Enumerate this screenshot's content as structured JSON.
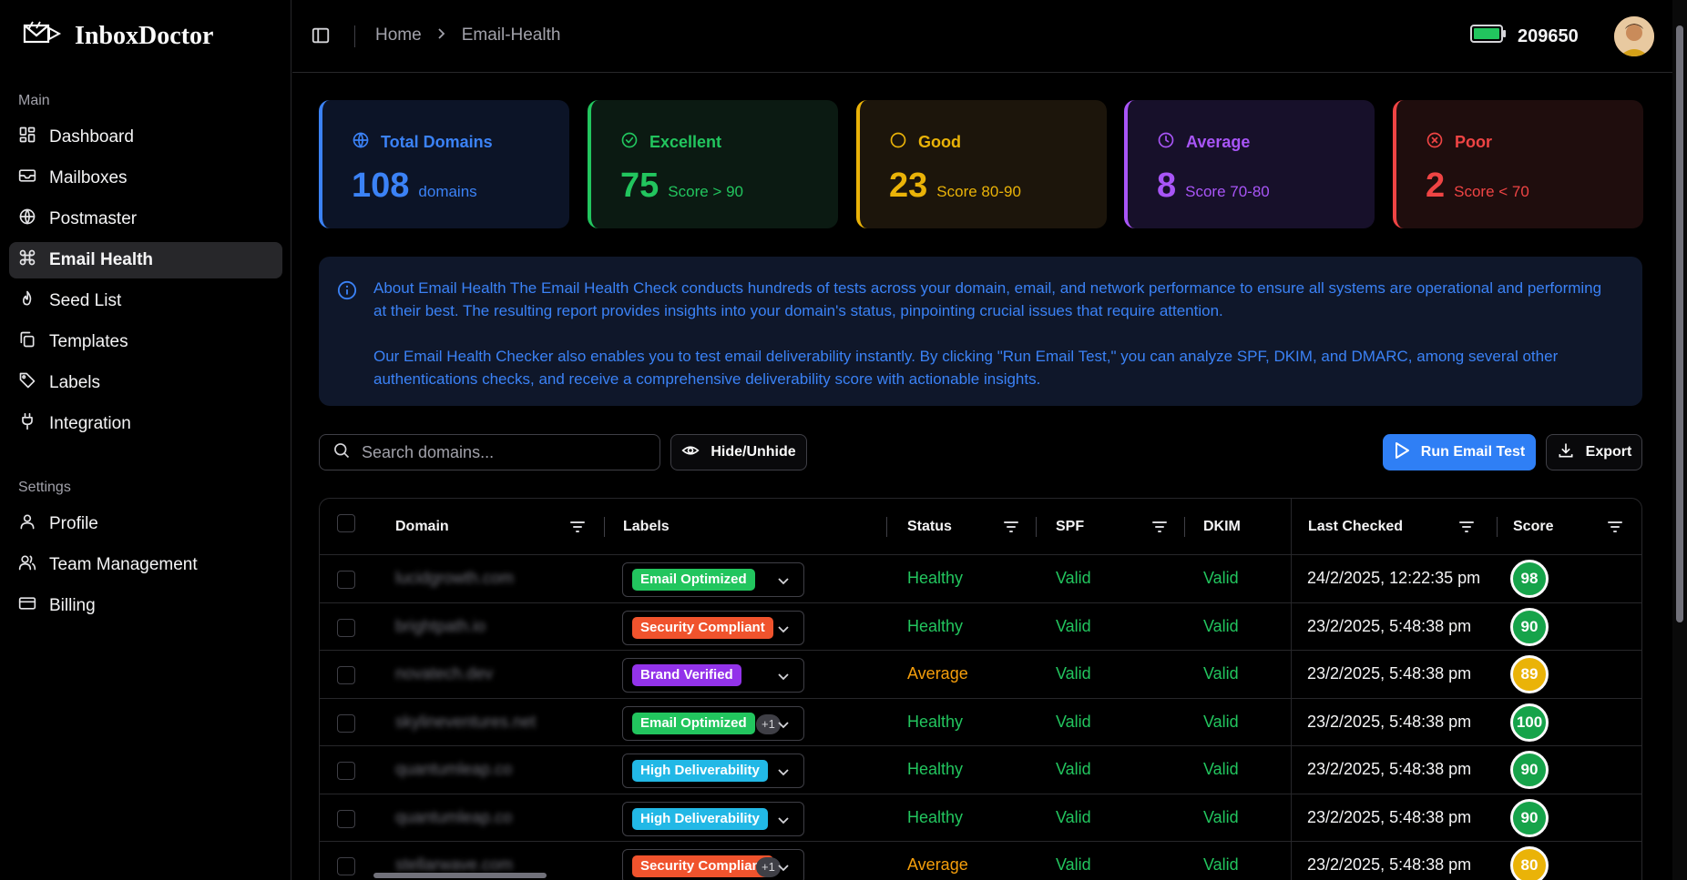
{
  "brand": {
    "name": "InboxDoctor"
  },
  "sidebar": {
    "main_label": "Main",
    "main_items": [
      {
        "label": "Dashboard",
        "icon": "dashboard-icon",
        "active": false
      },
      {
        "label": "Mailboxes",
        "icon": "mailbox-icon",
        "active": false
      },
      {
        "label": "Postmaster",
        "icon": "globe-icon",
        "active": false
      },
      {
        "label": "Email Health",
        "icon": "command-icon",
        "active": true
      },
      {
        "label": "Seed List",
        "icon": "flame-icon",
        "active": false
      },
      {
        "label": "Templates",
        "icon": "copy-icon",
        "active": false
      },
      {
        "label": "Labels",
        "icon": "tag-icon",
        "active": false
      },
      {
        "label": "Integration",
        "icon": "plug-icon",
        "active": false
      }
    ],
    "settings_label": "Settings",
    "settings_items": [
      {
        "label": "Profile",
        "icon": "user-icon"
      },
      {
        "label": "Team Management",
        "icon": "users-icon"
      },
      {
        "label": "Billing",
        "icon": "credit-card-icon"
      }
    ]
  },
  "topbar": {
    "breadcrumb": [
      "Home",
      "Email-Health"
    ],
    "credits": "209650"
  },
  "stats": [
    {
      "title": "Total Domains",
      "value": "108",
      "sub": "domains",
      "color": "#3b82f6",
      "bg": "#0c1427",
      "icon": "globe-icon"
    },
    {
      "title": "Excellent",
      "value": "75",
      "sub": "Score > 90",
      "color": "#22c55e",
      "bg": "#0b1a12",
      "icon": "check-circle-icon"
    },
    {
      "title": "Good",
      "value": "23",
      "sub": "Score 80-90",
      "color": "#eab308",
      "bg": "#1c150b",
      "icon": "circle-icon"
    },
    {
      "title": "Average",
      "value": "8",
      "sub": "Score 70-80",
      "color": "#a855f7",
      "bg": "#17102a",
      "icon": "clock-icon"
    },
    {
      "title": "Poor",
      "value": "2",
      "sub": "Score < 70",
      "color": "#ef4444",
      "bg": "#1f0d0d",
      "icon": "x-circle-icon"
    }
  ],
  "info": {
    "paragraph1": "About Email Health The Email Health Check conducts hundreds of tests across your domain, email, and network performance to ensure all systems are operational and performing at their best. The resulting report provides insights into your domain's status, pinpointing crucial issues that require attention.",
    "paragraph2": "Our Email Health Checker also enables you to test email deliverability instantly. By clicking \"Run Email Test,\" you can analyze SPF, DKIM, and DMARC, among several other authentications checks, and receive a comprehensive deliverability score with actionable insights."
  },
  "toolbar": {
    "search_placeholder": "Search domains...",
    "hide_label": "Hide/Unhide",
    "run_label": "Run Email Test",
    "export_label": "Export"
  },
  "table": {
    "headers": {
      "domain": "Domain",
      "labels": "Labels",
      "status": "Status",
      "spf": "SPF",
      "dkim": "DKIM",
      "last_checked": "Last Checked",
      "score": "Score"
    },
    "rows": [
      {
        "domain": "lucidgrowth.com",
        "label": "Email Optimized",
        "label_color": "#22c55e",
        "extra": "",
        "status": "Healthy",
        "spf": "Valid",
        "dkim": "Valid",
        "last_checked": "24/2/2025, 12:22:35 pm",
        "score": "98",
        "score_color": "#16a34a"
      },
      {
        "domain": "brightpath.io",
        "label": "Security Compliant",
        "label_color": "#f0532d",
        "extra": "",
        "status": "Healthy",
        "spf": "Valid",
        "dkim": "Valid",
        "last_checked": "23/2/2025, 5:48:38 pm",
        "score": "90",
        "score_color": "#16a34a"
      },
      {
        "domain": "novatech.dev",
        "label": "Brand Verified",
        "label_color": "#9333ea",
        "extra": "",
        "status": "Average",
        "spf": "Valid",
        "dkim": "Valid",
        "last_checked": "23/2/2025, 5:48:38 pm",
        "score": "89",
        "score_color": "#eab308"
      },
      {
        "domain": "skylineventures.net",
        "label": "Email Optimized",
        "label_color": "#22c55e",
        "extra": "+1",
        "status": "Healthy",
        "spf": "Valid",
        "dkim": "Valid",
        "last_checked": "23/2/2025, 5:48:38 pm",
        "score": "100",
        "score_color": "#16a34a"
      },
      {
        "domain": "quantumleap.co",
        "label": "High Deliverability",
        "label_color": "#22b8e6",
        "extra": "",
        "status": "Healthy",
        "spf": "Valid",
        "dkim": "Valid",
        "last_checked": "23/2/2025, 5:48:38 pm",
        "score": "90",
        "score_color": "#16a34a"
      },
      {
        "domain": "quantumleap.co",
        "label": "High Deliverability",
        "label_color": "#22b8e6",
        "extra": "",
        "status": "Healthy",
        "spf": "Valid",
        "dkim": "Valid",
        "last_checked": "23/2/2025, 5:48:38 pm",
        "score": "90",
        "score_color": "#16a34a"
      },
      {
        "domain": "stellarwave.com",
        "label": "Security Compliant",
        "label_color": "#f0532d",
        "extra": "+1",
        "status": "Average",
        "spf": "Valid",
        "dkim": "Valid",
        "last_checked": "23/2/2025, 5:48:38 pm",
        "score": "80",
        "score_color": "#eab308"
      }
    ]
  },
  "colors": {
    "healthy": "#22c55e",
    "average": "#f59e0b",
    "valid": "#22c55e"
  }
}
